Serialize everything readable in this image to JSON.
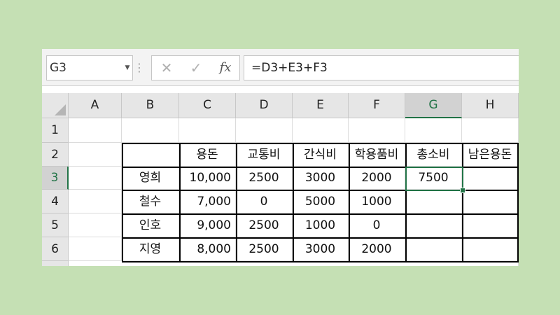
{
  "name_box": {
    "value": "G3"
  },
  "formula_bar": {
    "formula": "=D3+E3+F3",
    "fx_label": "fx"
  },
  "colors": {
    "accent": "#217346",
    "background": "#c5e0b4"
  },
  "icons": {
    "cancel": "close-icon",
    "enter": "check-icon",
    "dropdown": "chevron-down-icon"
  },
  "columns": [
    "A",
    "B",
    "C",
    "D",
    "E",
    "F",
    "G",
    "H"
  ],
  "rows": [
    "1",
    "2",
    "3",
    "4",
    "5",
    "6"
  ],
  "selected_cell": {
    "column": "G",
    "row": "3"
  },
  "sheet": {
    "headers": {
      "c": "용돈",
      "d": "교통비",
      "e": "간식비",
      "f": "학용품비",
      "g": "총소비",
      "h": "남은용돈"
    },
    "data": [
      {
        "name": "영희",
        "c": "10,000",
        "d": "2500",
        "e": "3000",
        "f": "2000",
        "g": "7500",
        "h": ""
      },
      {
        "name": "철수",
        "c": "7,000",
        "d": "0",
        "e": "5000",
        "f": "1000",
        "g": "",
        "h": ""
      },
      {
        "name": "인호",
        "c": "9,000",
        "d": "2500",
        "e": "1000",
        "f": "0",
        "g": "",
        "h": ""
      },
      {
        "name": "지영",
        "c": "8,000",
        "d": "2500",
        "e": "3000",
        "f": "2000",
        "g": "",
        "h": ""
      }
    ]
  }
}
